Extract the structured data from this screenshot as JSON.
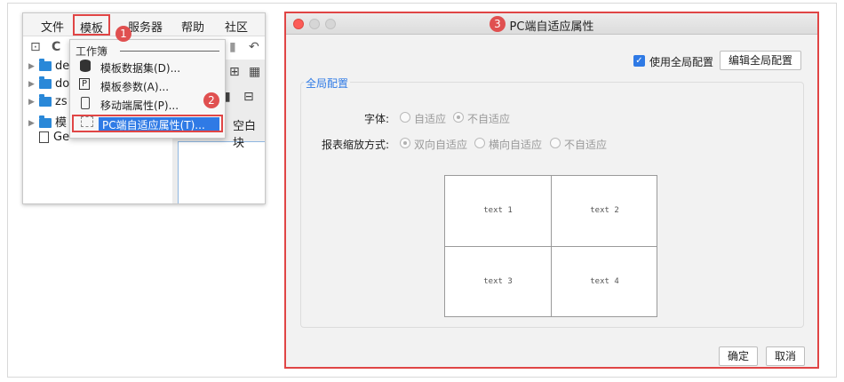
{
  "menubar": {
    "items": [
      "文件",
      "模板",
      "服务器",
      "帮助",
      "社区"
    ]
  },
  "tree": {
    "items": [
      {
        "label": "de"
      },
      {
        "label": "do"
      },
      {
        "label": "zs"
      },
      {
        "label": "模"
      },
      {
        "label": "Ge"
      }
    ]
  },
  "workspace": {
    "blank_block_label": "空白块"
  },
  "dropdown": {
    "header": "工作簿",
    "items": [
      {
        "label": "模板数据集(D)...",
        "icon": "database-icon"
      },
      {
        "label": "模板参数(A)...",
        "icon": "parameter-icon",
        "icon_glyph": "P"
      },
      {
        "label": "移动端属性(P)...",
        "icon": "mobile-icon"
      },
      {
        "label": "PC端自适应属性(T)...",
        "icon": "pc-adaptive-icon",
        "selected": true
      }
    ]
  },
  "badges": {
    "one": "1",
    "two": "2",
    "three": "3"
  },
  "dialog": {
    "title": "PC端自适应属性",
    "use_global_config": {
      "label": "使用全局配置",
      "checked": true,
      "check_glyph": "✓"
    },
    "edit_global_button": "编辑全局配置",
    "group_title": "全局配置",
    "font": {
      "label": "字体:",
      "options": [
        {
          "label": "自适应",
          "selected": false
        },
        {
          "label": "不自适应",
          "selected": true
        }
      ]
    },
    "scale": {
      "label": "报表缩放方式:",
      "options": [
        {
          "label": "双向自适应",
          "selected": true
        },
        {
          "label": "横向自适应",
          "selected": false
        },
        {
          "label": "不自适应",
          "selected": false
        }
      ]
    },
    "preview_cells": [
      "text 1",
      "text 2",
      "text 3",
      "text 4"
    ],
    "ok_button": "确定",
    "cancel_button": "取消"
  },
  "colors": {
    "highlight_red": "#e04545",
    "accent_blue": "#2f7ae5",
    "folder_blue": "#2a88d8"
  }
}
